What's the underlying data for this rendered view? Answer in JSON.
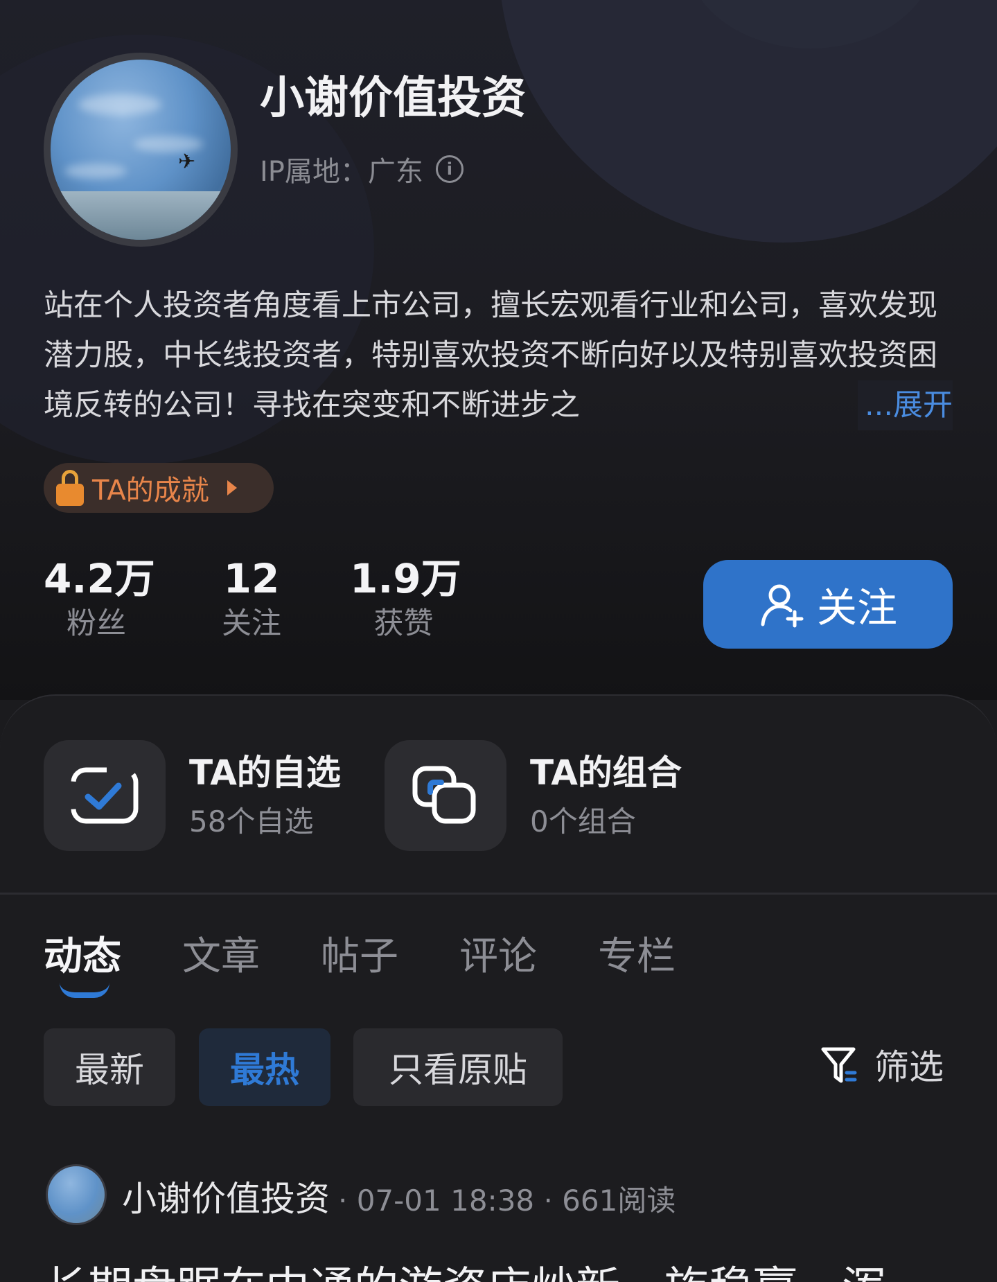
{
  "profile": {
    "name": "小谢价值投资",
    "ip_location": "IP属地：广东",
    "bio": "站在个人投资者角度看上市公司，擅长宏观看行业和公司，喜欢发现潜力股，中长线投资者，特别喜欢投资不断向好以及特别喜欢投资困境反转的公司！寻找在突变和不断进步之",
    "bio_expand": "...展开",
    "achievement_label": "TA的成就"
  },
  "stats": [
    {
      "value": "4.2万",
      "label": "粉丝"
    },
    {
      "value": "12",
      "label": "关注"
    },
    {
      "value": "1.9万",
      "label": "获赞"
    }
  ],
  "follow_button": {
    "label": "关注"
  },
  "quick_cards": [
    {
      "title": "TA的自选",
      "subtitle": "58个自选"
    },
    {
      "title": "TA的组合",
      "subtitle": "0个组合"
    }
  ],
  "tabs": [
    {
      "label": "动态",
      "active": true
    },
    {
      "label": "文章",
      "active": false
    },
    {
      "label": "帖子",
      "active": false
    },
    {
      "label": "评论",
      "active": false
    },
    {
      "label": "专栏",
      "active": false
    }
  ],
  "chips": [
    {
      "label": "最新",
      "active": false
    },
    {
      "label": "最热",
      "active": true
    },
    {
      "label": "只看原贴",
      "active": false
    }
  ],
  "filter_label": "筛选",
  "post": {
    "author": "小谢价值投资",
    "info": "· 07-01 18:38 · 661阅读",
    "title": "长期盘踞在中通的游资店炒新一族稳赢，浑"
  },
  "colors": {
    "accent": "#2f73c9",
    "achievement": "#e8854a",
    "background": "#1b1b1e"
  }
}
